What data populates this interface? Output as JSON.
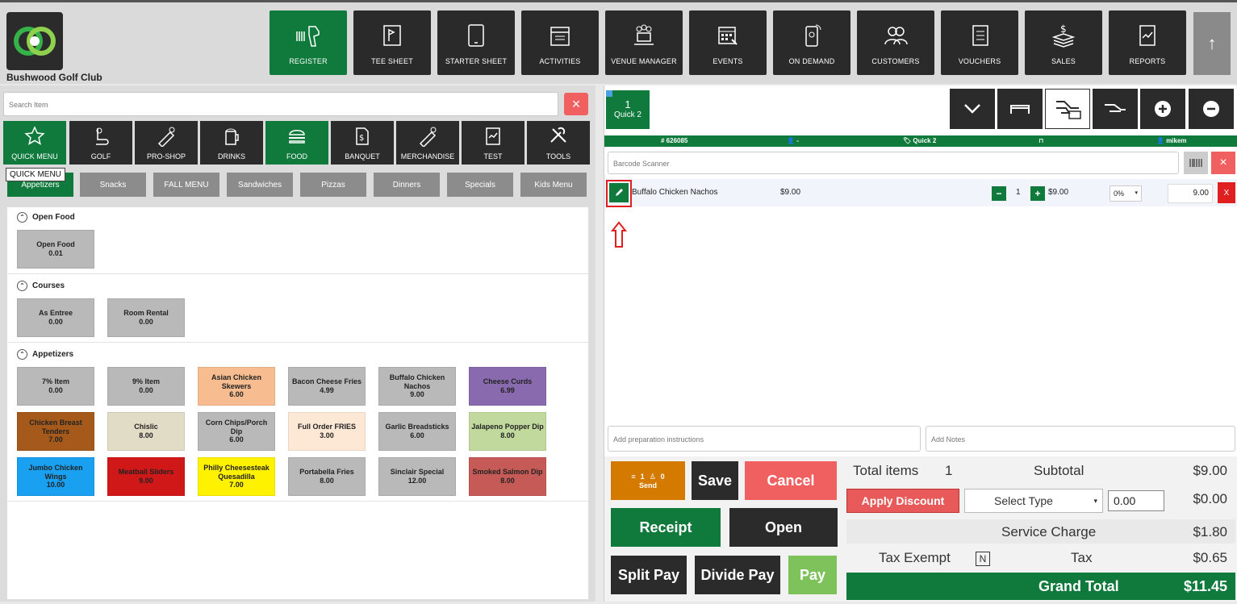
{
  "header": {
    "club_name": "Bushwood Golf Club",
    "nav": [
      {
        "label": "REGISTER",
        "icon": "barcode-scanner-icon",
        "active": true
      },
      {
        "label": "TEE SHEET",
        "icon": "tee-sheet-icon"
      },
      {
        "label": "STARTER SHEET",
        "icon": "tablet-icon"
      },
      {
        "label": "ACTIVITIES",
        "icon": "activities-icon"
      },
      {
        "label": "VENUE MANAGER",
        "icon": "venue-manager-icon"
      },
      {
        "label": "EVENTS",
        "icon": "calendar-icon"
      },
      {
        "label": "ON DEMAND",
        "icon": "phone-icon"
      },
      {
        "label": "CUSTOMERS",
        "icon": "customers-icon"
      },
      {
        "label": "VOUCHERS",
        "icon": "vouchers-icon"
      },
      {
        "label": "SALES",
        "icon": "sales-icon"
      },
      {
        "label": "REPORTS",
        "icon": "reports-icon"
      }
    ],
    "up_arrow": "↑"
  },
  "search": {
    "placeholder": "Search Item",
    "clear": "×"
  },
  "categories": [
    {
      "label": "QUICK MENU",
      "icon": "star-icon",
      "active": true
    },
    {
      "label": "GOLF",
      "icon": "golf-icon"
    },
    {
      "label": "PRO-SHOP",
      "icon": "pro-shop-icon"
    },
    {
      "label": "DRINKS",
      "icon": "drinks-icon"
    },
    {
      "label": "FOOD",
      "icon": "burger-icon",
      "active": true
    },
    {
      "label": "BANQUET",
      "icon": "banquet-icon"
    },
    {
      "label": "MERCHANDISE",
      "icon": "merchandise-icon"
    },
    {
      "label": "TEST",
      "icon": "test-icon"
    },
    {
      "label": "TOOLS",
      "icon": "tools-icon"
    }
  ],
  "tooltip": "QUICK MENU",
  "subcategories": [
    "Appetizers",
    "Snacks",
    "FALL MENU",
    "Sandwiches",
    "Pizzas",
    "Dinners",
    "Specials",
    "Kids Menu"
  ],
  "sections": [
    {
      "title": "Open Food",
      "items": [
        {
          "name": "Open Food",
          "price": "0.01",
          "color": "#b9b9b9"
        }
      ]
    },
    {
      "title": "Courses",
      "items": [
        {
          "name": "As Entree",
          "price": "0.00",
          "color": "#b9b9b9"
        },
        {
          "name": "Room Rental",
          "price": "0.00",
          "color": "#b9b9b9"
        }
      ]
    },
    {
      "title": "Appetizers",
      "items": [
        {
          "name": "7% Item",
          "price": "0.00",
          "color": "#b9b9b9"
        },
        {
          "name": "9% Item",
          "price": "0.00",
          "color": "#b9b9b9"
        },
        {
          "name": "Asian Chicken Skewers",
          "price": "6.00",
          "color": "#f7bc8f"
        },
        {
          "name": "Bacon Cheese Fries",
          "price": "4.99",
          "color": "#b9b9b9"
        },
        {
          "name": "Buffalo Chicken Nachos",
          "price": "9.00",
          "color": "#b9b9b9"
        },
        {
          "name": "Cheese Curds",
          "price": "6.99",
          "color": "#8a6aae"
        },
        {
          "name": "Chicken Breast Tenders",
          "price": "7.00",
          "color": "#a55a1c"
        },
        {
          "name": "Chislic",
          "price": "8.00",
          "color": "#e1dcc6"
        },
        {
          "name": "Corn Chips/Porch Dip",
          "price": "6.00",
          "color": "#b9b9b9"
        },
        {
          "name": "Full Order FRIES",
          "price": "3.00",
          "color": "#fde8d6"
        },
        {
          "name": "Garlic Breadsticks",
          "price": "6.00",
          "color": "#b9b9b9"
        },
        {
          "name": "Jalapeno Popper Dip",
          "price": "8.00",
          "color": "#c1d99c"
        },
        {
          "name": "Jumbo Chicken Wings",
          "price": "10.00",
          "color": "#1aa0f0"
        },
        {
          "name": "Meatball Sliders",
          "price": "9.00",
          "color": "#d01818"
        },
        {
          "name": "Philly Cheesesteak Quesadilla",
          "price": "7.00",
          "color": "#fff200"
        },
        {
          "name": "Portabella Fries",
          "price": "8.00",
          "color": "#b9b9b9"
        },
        {
          "name": "Sinclair Special",
          "price": "12.00",
          "color": "#b9b9b9"
        },
        {
          "name": "Smoked Salmon Dip",
          "price": "8.00",
          "color": "#c65a56"
        }
      ]
    }
  ],
  "order": {
    "tab_number": "1",
    "tab_name": "Quick 2",
    "info": {
      "ticket": "# 626085",
      "player": "-",
      "tag": "Quick 2",
      "table": "",
      "user": "mikem"
    },
    "barcode_placeholder": "Barcode Scanner",
    "clear": "×",
    "line": {
      "name": "Buffalo Chicken Nachos",
      "price": "$9.00",
      "qty": "1",
      "unit": "$9.00",
      "discount": "0%",
      "total": "9.00",
      "remove": "X",
      "minus": "−",
      "plus": "+"
    },
    "prep_placeholder": "Add preparation instructions",
    "notes_placeholder": "Add Notes"
  },
  "actions": {
    "send_count_1": "1",
    "send_count_2": "0",
    "send": "Send",
    "save": "Save",
    "cancel": "Cancel",
    "receipt": "Receipt",
    "open": "Open",
    "split_pay": "Split Pay",
    "divide_pay": "Divide Pay",
    "pay": "Pay"
  },
  "totals": {
    "total_items_label": "Total items",
    "total_items": "1",
    "subtotal_label": "Subtotal",
    "subtotal": "$9.00",
    "apply_discount": "Apply Discount",
    "select_type": "Select Type",
    "discount_value": "0.00",
    "discount_amount": "$0.00",
    "service_charge_label": "Service Charge",
    "service_charge": "$1.80",
    "tax_exempt_label": "Tax Exempt",
    "tax_exempt_value": "N",
    "tax_label": "Tax",
    "tax": "$0.65",
    "grand_total_label": "Grand Total",
    "grand_total": "$11.45"
  },
  "colors": {
    "green": "#0f7a3c",
    "dark": "#2b2b2b",
    "red": "#f06060",
    "orange": "#d47a00"
  }
}
